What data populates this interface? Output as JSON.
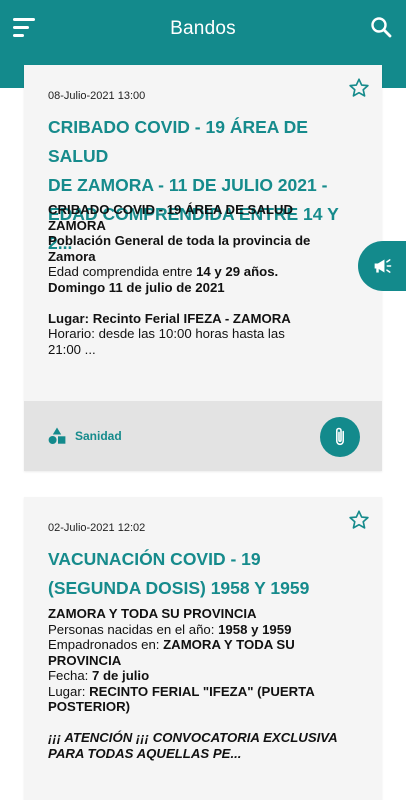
{
  "app": {
    "title": "Bandos",
    "accent_color": "#138a8c",
    "menu_icon": "menu-icon",
    "search_icon": "search-icon",
    "side_button_icon": "megaphone-icon"
  },
  "cards": [
    {
      "date": "08-Julio-2021 13:00",
      "title_lines": [
        "CRIBADO COVID - 19 ÁREA DE SALUD",
        "DE ZAMORA - 11 DE JULIO 2021 -",
        "EDAD COMPRENDIDA ENTRE 14 Y 2..."
      ],
      "body": {
        "l1": "CRIBADO COVID - 19 ÁREA DE SALUD",
        "l2": "ZAMORA",
        "l3": "Población General de toda la provincia de",
        "l4": "Zamora",
        "l5a": "Edad comprendida entre ",
        "l5b": "14 y 29 años.",
        "l6": "Domingo 11 de julio de 2021",
        "l8": "Lugar: Recinto Ferial IFEZA - ZAMORA",
        "l9": "Horario: desde las 10:00 horas hasta las",
        "l10": "21:00 ..."
      },
      "category": "Sanidad",
      "category_icon": "shapes-icon",
      "attachment_icon": "paperclip-icon",
      "favorite_icon": "star-outline-icon"
    },
    {
      "date": "02-Julio-2021 12:02",
      "title_lines": [
        "VACUNACIÓN COVID - 19",
        "(SEGUNDA DOSIS) 1958 Y 1959"
      ],
      "body": {
        "l1": "ZAMORA Y TODA SU PROVINCIA",
        "l2a": "Personas nacidas en el año: ",
        "l2b": "1958 y 1959",
        "l3a": "Empadronados en: ",
        "l3b": "ZAMORA Y TODA SU",
        "l4": "PROVINCIA",
        "l5a": "Fecha: ",
        "l5b": "7 de julio",
        "l6a": "Lugar: ",
        "l6b": "RECINTO FERIAL \"IFEZA\" (PUERTA",
        "l7": "POSTERIOR)",
        "l9": "¡¡¡ ATENCIÓN ¡¡¡ CONVOCATORIA EXCLUSIVA",
        "l10": "PARA TODAS AQUELLAS PE..."
      },
      "favorite_icon": "star-outline-icon"
    }
  ]
}
